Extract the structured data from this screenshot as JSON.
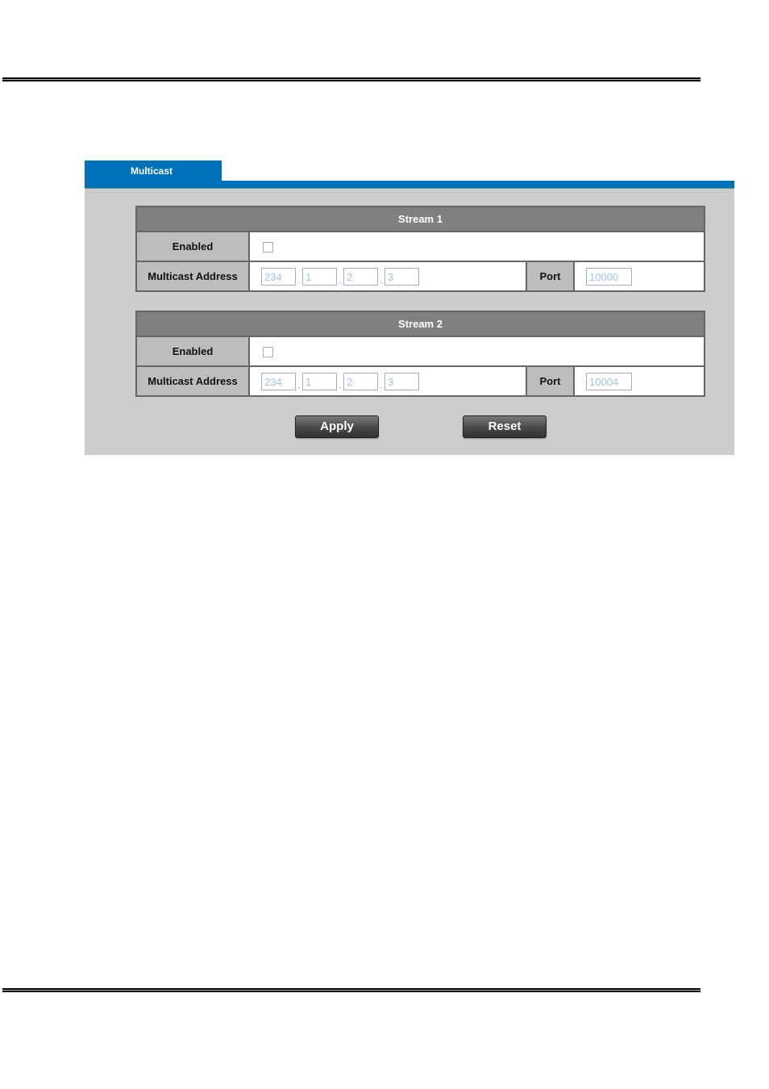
{
  "tab": {
    "label": "Multicast"
  },
  "streams": [
    {
      "title": "Stream 1",
      "enabled_label": "Enabled",
      "enabled": false,
      "address_label": "Multicast Address",
      "address": [
        "234",
        "1",
        "2",
        "3"
      ],
      "port_label": "Port",
      "port": "10000"
    },
    {
      "title": "Stream 2",
      "enabled_label": "Enabled",
      "enabled": false,
      "address_label": "Multicast Address",
      "address": [
        "234",
        "1",
        "2",
        "3"
      ],
      "port_label": "Port",
      "port": "10004"
    }
  ],
  "buttons": {
    "apply": "Apply",
    "reset": "Reset"
  },
  "colors": {
    "accent": "#0070bb",
    "header": "#808080",
    "label_bg": "#bdbdbd",
    "panel_bg": "#cccccc"
  }
}
